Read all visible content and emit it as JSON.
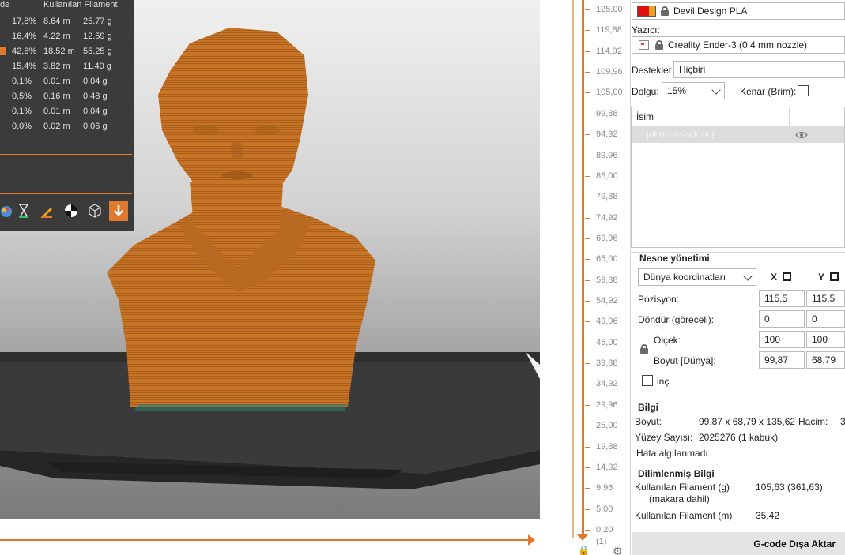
{
  "stats": {
    "header_left": "de",
    "header_filament": "Kullanılan Filament",
    "rows": [
      {
        "pct": "17,8%",
        "len": "8.64 m",
        "weight": "25.77 g",
        "color": ""
      },
      {
        "pct": "16,4%",
        "len": "4.22 m",
        "weight": "12.59 g",
        "color": ""
      },
      {
        "pct": "42,6%",
        "len": "18.52 m",
        "weight": "55.25 g",
        "color": "#e07a2c"
      },
      {
        "pct": "15,4%",
        "len": "3.82 m",
        "weight": "11.40 g",
        "color": ""
      },
      {
        "pct": "0,1%",
        "len": "0.01 m",
        "weight": "0.04 g",
        "color": ""
      },
      {
        "pct": "0,5%",
        "len": "0.16 m",
        "weight": "0.48 g",
        "color": ""
      },
      {
        "pct": "0,1%",
        "len": "0.01 m",
        "weight": "0.04 g",
        "color": ""
      },
      {
        "pct": "0,0%",
        "len": "0.02 m",
        "weight": "0.06 g",
        "color": ""
      }
    ],
    "tools": [
      "color-palette-icon",
      "hourglass-icon",
      "pencil-icon",
      "calibration-icon",
      "cube-icon",
      "export-down-icon"
    ]
  },
  "viewport": {
    "slice_id": "873601",
    "model_color": "#c87426"
  },
  "layers": {
    "labels": [
      "125,00",
      "119,88",
      "114,92",
      "109,96",
      "105,00",
      "99,88",
      "94,92",
      "89,96",
      "85,00",
      "79,88",
      "74,92",
      "69,96",
      "65,00",
      "59,88",
      "54,92",
      "49,96",
      "45,00",
      "39,88",
      "34,92",
      "29,96",
      "25,00",
      "19,88",
      "14,92",
      "9,96",
      "5,00",
      "0,20"
    ],
    "count": "(1)"
  },
  "panel": {
    "filament": "Devil Design PLA",
    "printer_label": "Yazıcı:",
    "printer": "Creality Ender-3 (0.4 mm nozzle)",
    "supports_label": "Destekler:",
    "supports": "Hiçbiri",
    "infill_label": "Dolgu:",
    "infill": "15%",
    "brim_label": "Kenar (Brim):",
    "table_header": "İsim",
    "object_name": "johncussack.obj",
    "object_mgmt_title": "Nesne yönetimi",
    "coord_system": "Dünya koordinatları",
    "axis_x": "X",
    "axis_y": "Y",
    "position_label": "Pozisyon:",
    "position_x": "115,5",
    "position_y": "115,5",
    "rotate_label": "Döndür (göreceli):",
    "rotate_x": "0",
    "rotate_y": "0",
    "scale_label": "Ölçek:",
    "scale_x": "100",
    "scale_y": "100",
    "size_label": "Boyut [Dünya]:",
    "size_x": "99,87",
    "size_y": "68,79",
    "inch_label": "inç",
    "info_title": "Bilgi",
    "info_size_label": "Boyut:",
    "info_size": "99,87 x 68,79 x 135,62",
    "info_volume_label": "Hacim:",
    "info_volume": "3",
    "info_facets_label": "Yüzey Sayısı:",
    "info_facets": "2025276 (1 kabuk)",
    "info_errors": "Hata algılanmadı",
    "sliced_title": "Dilimlenmiş Bilgi",
    "used_g_label": "Kullanılan Filament (g)",
    "used_g_sub": "(makara dahil)",
    "used_g": "105,63 (361,63)",
    "used_m_label": "Kullanılan Filament (m)",
    "used_m": "35,42",
    "export_label": "G-code Dışa Aktar",
    "filament_color_1": "#e01010",
    "filament_color_2": "#f0a020"
  }
}
